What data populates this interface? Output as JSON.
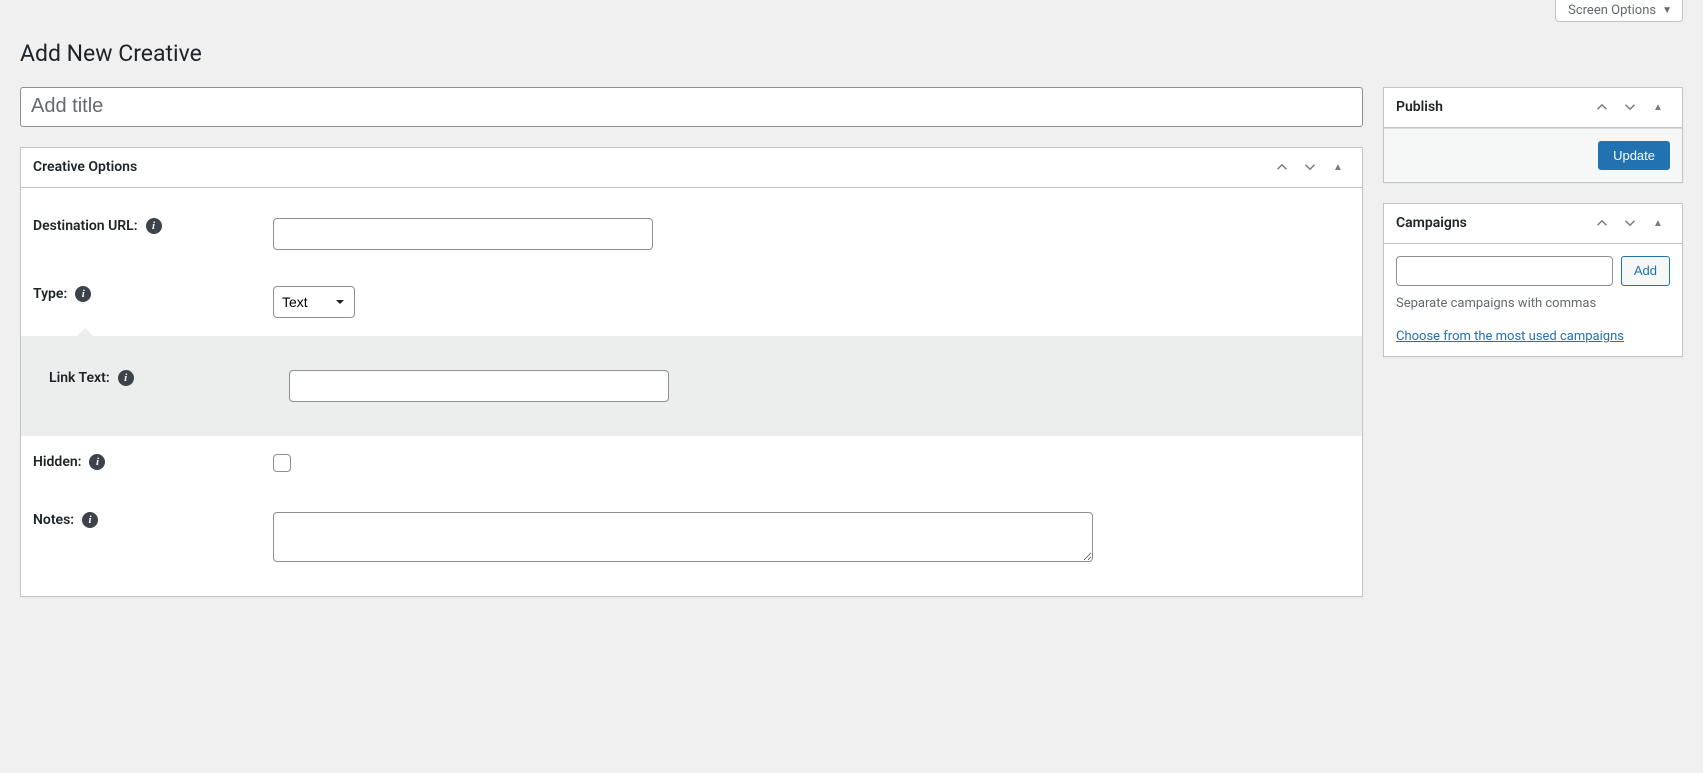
{
  "topbar": {
    "screen_options_label": "Screen Options"
  },
  "page_title": "Add New Creative",
  "title_placeholder": "Add title",
  "creative_options": {
    "panel_title": "Creative Options",
    "destination_url_label": "Destination URL:",
    "destination_url_value": "",
    "type_label": "Type:",
    "type_selected": "Text",
    "link_text_label": "Link Text:",
    "link_text_value": "",
    "hidden_label": "Hidden:",
    "notes_label": "Notes:",
    "notes_value": ""
  },
  "publish": {
    "panel_title": "Publish",
    "update_label": "Update"
  },
  "campaigns": {
    "panel_title": "Campaigns",
    "add_label": "Add",
    "howto": "Separate campaigns with commas",
    "most_used_link": "Choose from the most used campaigns"
  }
}
